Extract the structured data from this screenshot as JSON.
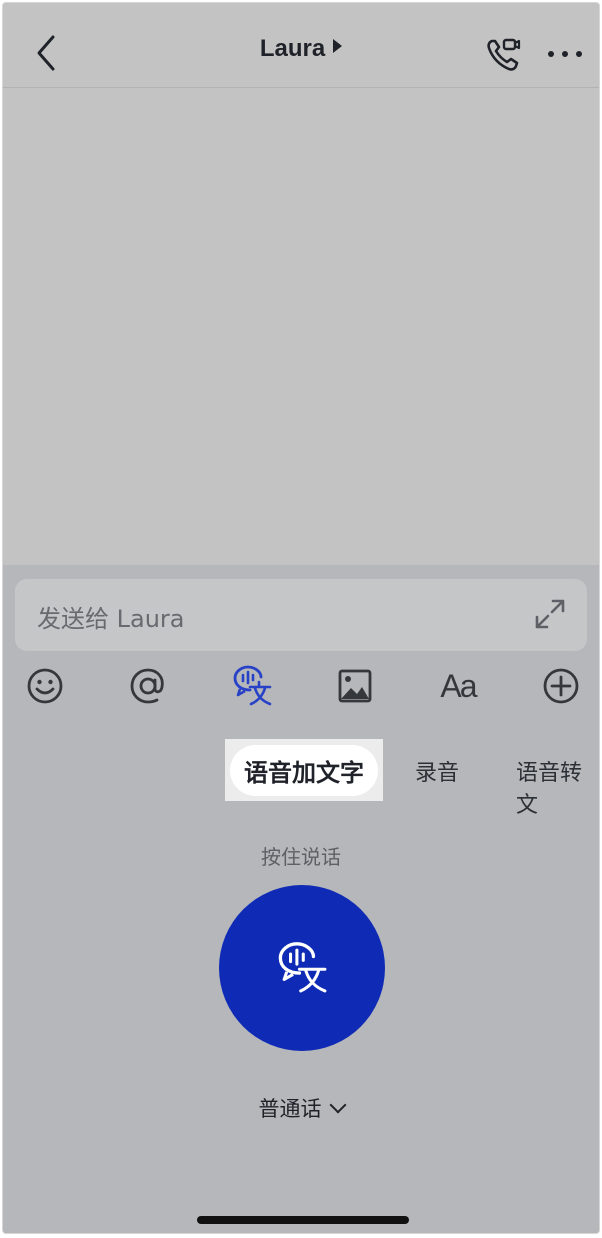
{
  "header": {
    "title": "Laura"
  },
  "composer": {
    "placeholder": "发送给 Laura",
    "toolbar_icons": [
      "emoji-icon",
      "mention-icon",
      "voice-to-text-icon",
      "image-icon",
      "font-icon",
      "plus-icon"
    ],
    "font_icon_text": "Aa",
    "accent_color": "#2741c7"
  },
  "voice": {
    "modes": [
      "语音加文字",
      "录音",
      "语音转文"
    ],
    "active_mode": "语音加文字",
    "hint": "按住说话",
    "language": "普通话",
    "button_color": "#0f2bb6"
  }
}
